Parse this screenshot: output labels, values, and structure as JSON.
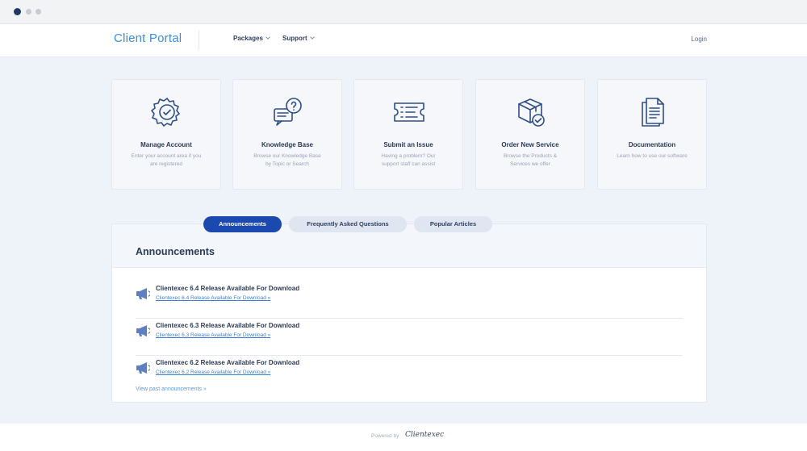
{
  "header": {
    "brand": "Client Portal",
    "nav": [
      {
        "label": "Packages"
      },
      {
        "label": "Support"
      }
    ],
    "login_label": "Login"
  },
  "cards": [
    {
      "title": "Manage Account",
      "desc": "Enter your account area if you are registered",
      "icon": "gear-check-icon"
    },
    {
      "title": "Knowledge Base",
      "desc": "Browse our Knowledge Base by Topic or Search",
      "icon": "chat-question-icon"
    },
    {
      "title": "Submit an Issue",
      "desc": "Having a problem? Our support staff can assist",
      "icon": "ticket-icon"
    },
    {
      "title": "Order New Service",
      "desc": "Browse the Products & Services we offer",
      "icon": "package-check-icon"
    },
    {
      "title": "Documentation",
      "desc": "Learn how to use our software",
      "icon": "document-icon"
    }
  ],
  "tabs": [
    {
      "label": "Announcements",
      "active": true
    },
    {
      "label": "Frequently Asked Questions",
      "active": false
    },
    {
      "label": "Popular Articles",
      "active": false
    }
  ],
  "panel": {
    "title": "Announcements",
    "items": [
      {
        "title": "Clientexec 6.4 Release Available For Download",
        "link": "Clientexec 6.4 Release Available For Download »"
      },
      {
        "title": "Clientexec 6.3 Release Available For Download",
        "link": "Clientexec 6.3 Release Available For Download »"
      },
      {
        "title": "Clientexec 6.2 Release Available For Download",
        "link": "Clientexec 6.2 Release Available For Download »"
      }
    ],
    "view_past": "View past announcements »"
  },
  "footer": {
    "powered_by": "Powered by",
    "logo_text": "Clientexec"
  },
  "colors": {
    "accent": "#1b49b0",
    "brand": "#3d8fd8",
    "background": "#eef2f9",
    "icon_stroke": "#2e4f86"
  }
}
